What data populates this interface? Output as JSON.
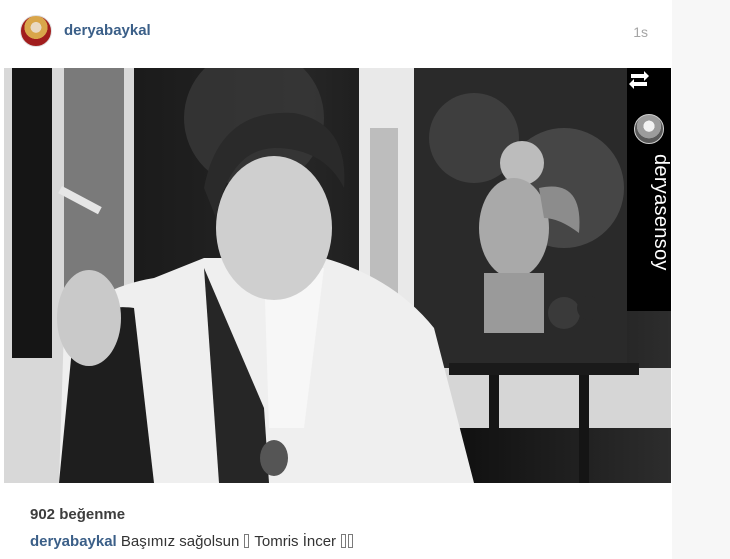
{
  "post": {
    "username": "deryabaykal",
    "timestamp": "1s",
    "image_description": "",
    "repost": {
      "username": "deryasensoy"
    },
    "likes": "902 beğenme",
    "caption": {
      "username": "deryabaykal",
      "text_part1": "Başımız sağolsun",
      "text_part2": "Tomris İncer"
    }
  },
  "colors": {
    "username_link": "#3b5f88",
    "timestamp": "#a5a5a5",
    "repost_strip": "#000000"
  }
}
